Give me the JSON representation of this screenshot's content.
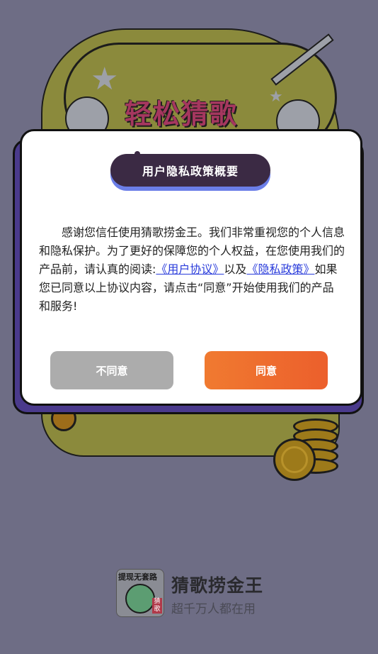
{
  "background": {
    "title": "轻松猜歌"
  },
  "dialog": {
    "title": "用户隐私政策概要",
    "body_intro": "感谢您信任使用猜歌捞金王。我们非常重视您的个人信息和隐私保护。为了更好的保障您的个人权益，在您使用我们的产品前，请认真的阅读:",
    "link_user_agreement": "《用户协议》",
    "body_and": "以及",
    "link_privacy_policy": "《隐私政策》",
    "body_outro": "如果您已同意以上协议内容，请点击“同意”开始使用我们的产品和服务!",
    "disagree_label": "不同意",
    "agree_label": "同意"
  },
  "brand": {
    "logo_text": "提现无套路",
    "logo_tag": "猜歌",
    "name": "猜歌捞金王",
    "slogan": "超千万人都在用"
  }
}
